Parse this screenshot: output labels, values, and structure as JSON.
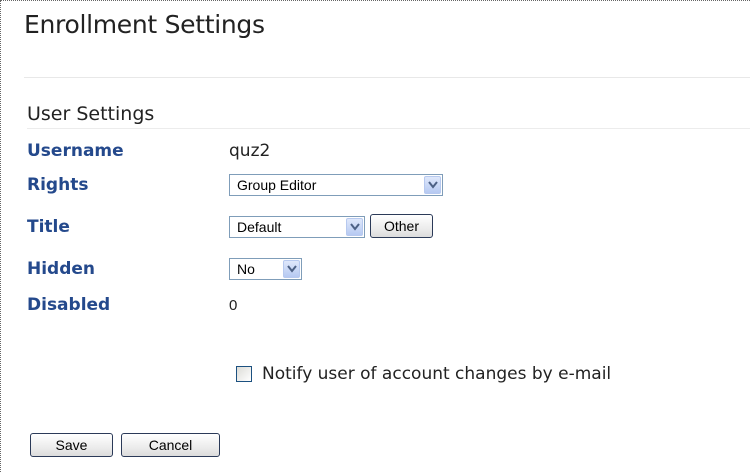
{
  "page": {
    "title": "Enrollment Settings"
  },
  "user_settings": {
    "heading": "User Settings",
    "username": {
      "label": "Username",
      "value": "quz2"
    },
    "rights": {
      "label": "Rights",
      "selected": "Group Editor"
    },
    "title": {
      "label": "Title",
      "selected": "Default",
      "other_button": "Other"
    },
    "hidden": {
      "label": "Hidden",
      "selected": "No"
    },
    "disabled": {
      "label": "Disabled",
      "value": "0"
    }
  },
  "notify": {
    "label": "Notify user of account changes by e-mail",
    "checked": false
  },
  "actions": {
    "save": "Save",
    "cancel": "Cancel"
  },
  "colors": {
    "label": "#24498c",
    "select_border": "#7f9db9"
  },
  "icons": {
    "dropdown": "chevron-down-icon"
  }
}
